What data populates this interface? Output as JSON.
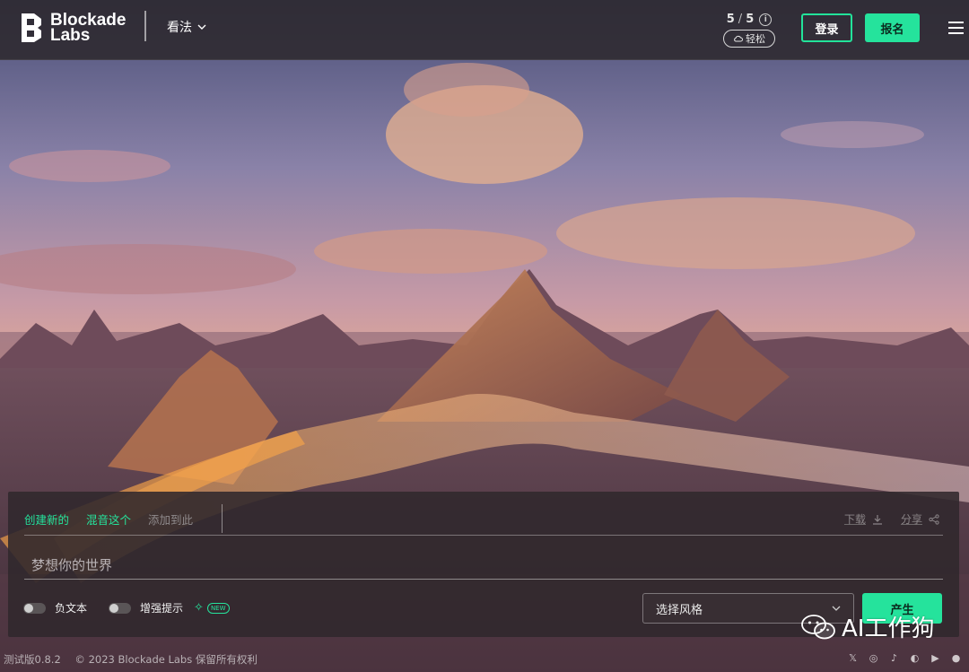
{
  "brand": {
    "name_line1": "Blockade",
    "name_line2": "Labs"
  },
  "header": {
    "view_menu_label": "看法",
    "credits": {
      "used": "5",
      "separator": "/",
      "total": "5",
      "info": "i",
      "mode": "轻松"
    },
    "login_label": "登录",
    "signup_label": "报名"
  },
  "panel": {
    "tabs": [
      {
        "label": "创建新的",
        "state": "active"
      },
      {
        "label": "混音这个",
        "state": "active"
      },
      {
        "label": "添加到此",
        "state": "disabled"
      }
    ],
    "actions": {
      "download_label": "下载",
      "share_label": "分享"
    },
    "prompt": {
      "placeholder": "梦想你的世界",
      "value": ""
    },
    "negative_text_label": "负文本",
    "enhance_prompt_label": "增强提示",
    "new_badge": "NEW",
    "style_select": {
      "selected": "选择风格"
    },
    "generate_label": "产生"
  },
  "footer": {
    "version": "测试版0.8.2",
    "copyright": "© 2023 Blockade Labs 保留所有权利"
  },
  "socials": [
    "x-icon",
    "instagram-icon",
    "tiktok-icon",
    "discord-icon",
    "youtube-icon",
    "reddit-icon"
  ],
  "watermark": {
    "text": "AI工作狗"
  },
  "colors": {
    "accent": "#25e39c",
    "header_bg": "#2c282c",
    "panel_bg": "#30282c"
  }
}
